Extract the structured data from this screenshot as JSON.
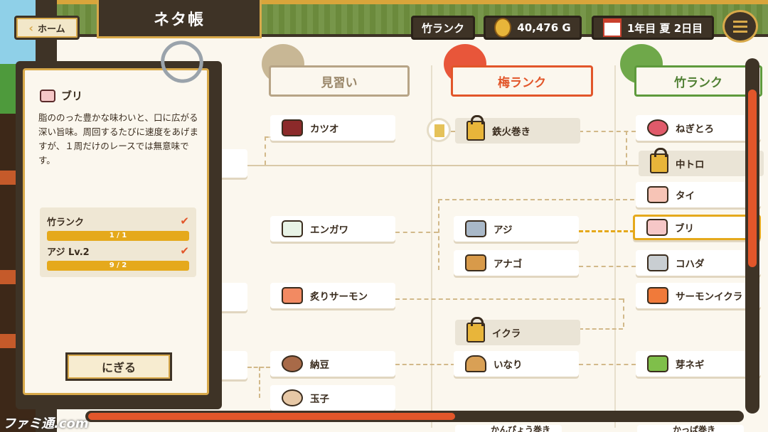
{
  "header": {
    "home_label": "ホーム",
    "title": "ネタ帳",
    "rank": "竹ランク",
    "gold": "40,476 G",
    "date": "1年目 夏 2日目"
  },
  "detail": {
    "name": "ブリ",
    "description": "脂ののった豊かな味わいと、口に広がる深い旨味。周回するたびに速度をあげますが、１周だけのレースでは無意味です。",
    "requirements": [
      {
        "label": "竹ランク",
        "progress": "1 / 1"
      },
      {
        "label": "アジ Lv.2",
        "progress": "9 / 2"
      }
    ],
    "action_label": "にぎる"
  },
  "ranks": [
    {
      "label": "見習い",
      "color": "#b7a486"
    },
    {
      "label": "梅ランク",
      "color": "#e2562a"
    },
    {
      "label": "竹ランク",
      "color": "#5e9a3c"
    }
  ],
  "cards": {
    "katsuo": "カツオ",
    "engawa": "エンガワ",
    "aburi_salmon": "炙りサーモン",
    "natto": "納豆",
    "tamago": "玉子",
    "tekka": "鉄火巻き",
    "aji": "アジ",
    "anago": "アナゴ",
    "ikura": "イクラ",
    "inari": "いなり",
    "negitoro": "ねぎとろ",
    "chutoro": "中トロ",
    "tai": "タイ",
    "buri": "ブリ",
    "kohada": "コハダ",
    "salmon_ikura": "サーモンイクラ",
    "menegi": "芽ネギ",
    "kanpyo": "かんぴょう巻き",
    "kappa": "かっぱ巻き"
  },
  "watermark": "ファミ通.com"
}
